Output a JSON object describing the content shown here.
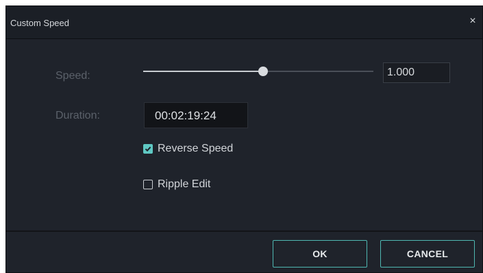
{
  "dialog": {
    "title": "Custom Speed",
    "close_glyph": "×"
  },
  "speed": {
    "label": "Speed:",
    "value": "1.000",
    "slider_fraction": 0.52
  },
  "duration": {
    "label": "Duration:",
    "value": "00:02:19:24"
  },
  "options": {
    "reverse_speed": {
      "label": "Reverse Speed",
      "checked": true
    },
    "ripple_edit": {
      "label": "Ripple Edit",
      "checked": false
    }
  },
  "buttons": {
    "ok_label": "OK",
    "cancel_label": "CANCEL"
  },
  "colors": {
    "accent": "#5fc8c3",
    "background": "#1f232b"
  }
}
